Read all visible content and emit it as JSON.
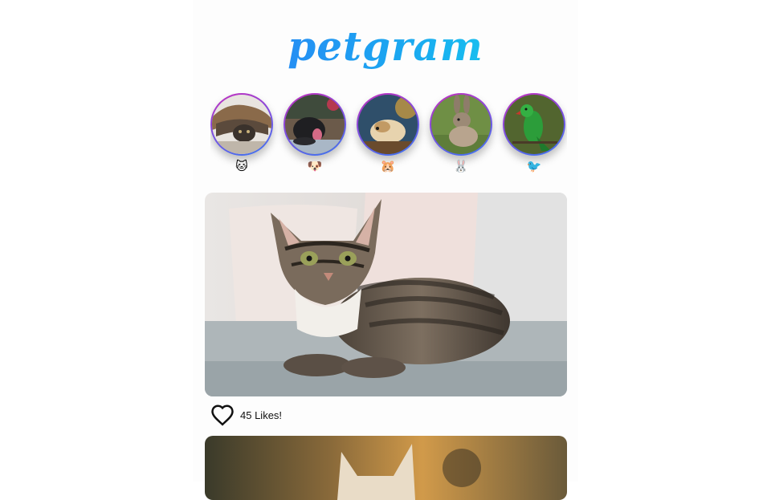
{
  "app": {
    "logo": "petgram"
  },
  "stories": [
    {
      "emoji": "🐱",
      "icon": "cat-category-icon",
      "colors": [
        "#5b4a3c",
        "#2b2420",
        "#bfa98a"
      ]
    },
    {
      "emoji": "🐶",
      "icon": "dog-category-icon",
      "colors": [
        "#3b4a3a",
        "#1f1f22",
        "#a9b7c6"
      ]
    },
    {
      "emoji": "🐹",
      "icon": "hamster-category-icon",
      "colors": [
        "#2f4f6a",
        "#e7d3ae",
        "#6a4b2d"
      ]
    },
    {
      "emoji": "🐰",
      "icon": "rabbit-category-icon",
      "colors": [
        "#5e7d3a",
        "#8e7c6a",
        "#b8a48e"
      ]
    },
    {
      "emoji": "🐦",
      "icon": "bird-category-icon",
      "colors": [
        "#52652f",
        "#2c9d3a",
        "#c23a2c"
      ]
    }
  ],
  "posts": [
    {
      "likes_label": "45 Likes!"
    }
  ]
}
